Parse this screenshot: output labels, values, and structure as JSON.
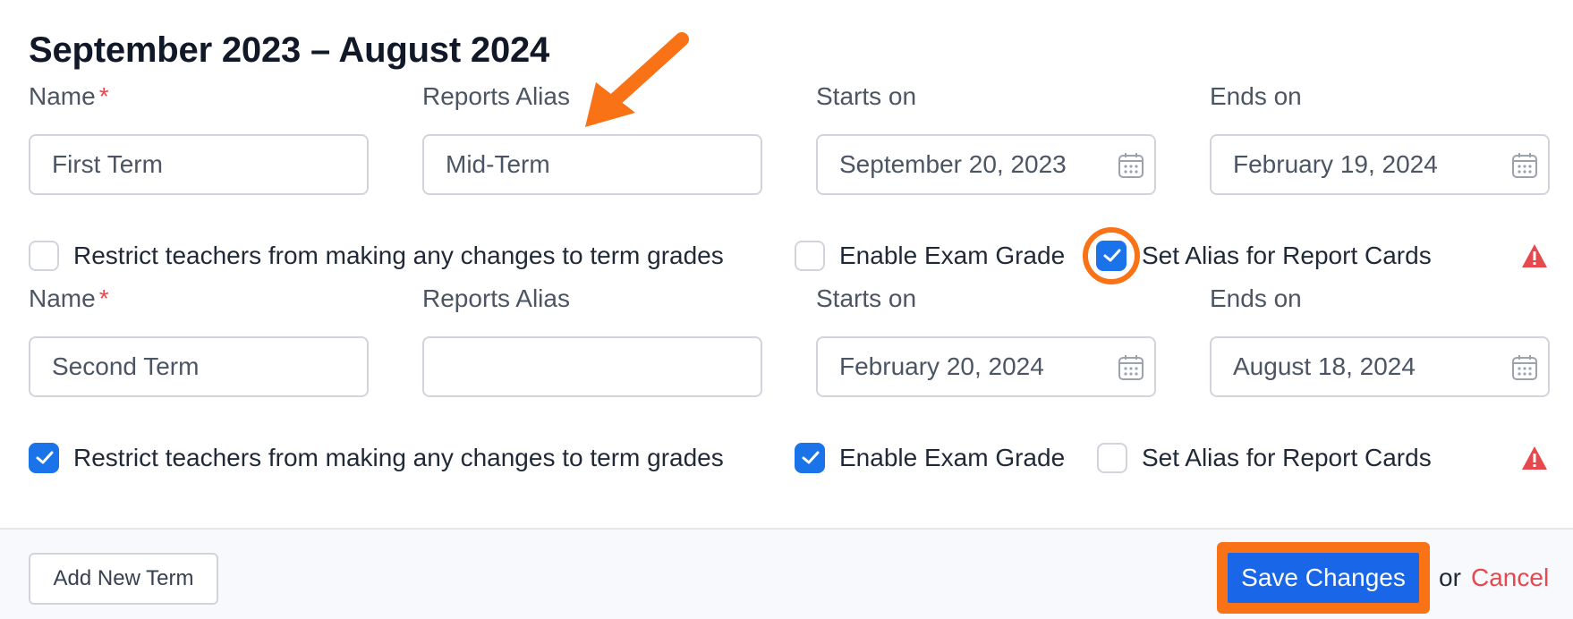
{
  "heading": "September 2023 – August 2024",
  "labels": {
    "name": "Name",
    "required_mark": "*",
    "reports_alias": "Reports Alias",
    "starts_on": "Starts on",
    "ends_on": "Ends on"
  },
  "terms": [
    {
      "name": "First Term",
      "reports_alias": "Mid-Term",
      "starts_on": "September 20, 2023",
      "ends_on": "February 19, 2024",
      "restrict_label": "Restrict teachers from making any changes to term grades",
      "restrict_checked": false,
      "exam_label": "Enable Exam Grade",
      "exam_checked": false,
      "alias_label": "Set Alias for Report Cards",
      "alias_checked": true
    },
    {
      "name": "Second Term",
      "reports_alias": "",
      "starts_on": "February 20, 2024",
      "ends_on": "August 18, 2024",
      "restrict_label": "Restrict teachers from making any changes to term grades",
      "restrict_checked": true,
      "exam_label": "Enable Exam Grade",
      "exam_checked": true,
      "alias_label": "Set Alias for Report Cards",
      "alias_checked": false
    }
  ],
  "footer": {
    "add_term": "Add New Term",
    "save": "Save Changes",
    "or": "or",
    "cancel": "Cancel"
  },
  "colors": {
    "accent": "#1a66e8",
    "annotation": "#f97316",
    "danger": "#e5484d"
  },
  "icons": {
    "calendar": "calendar-icon",
    "warning": "warning-icon",
    "check": "check-icon"
  }
}
